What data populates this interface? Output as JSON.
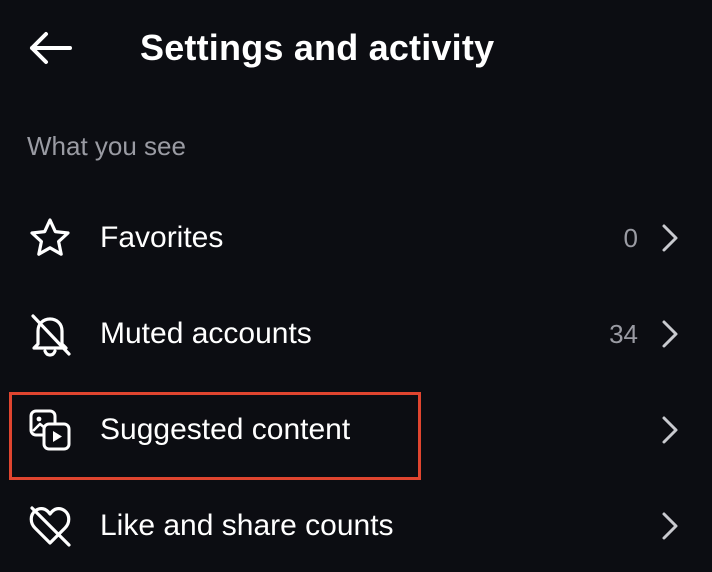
{
  "header": {
    "back_icon": "arrow-left-icon",
    "title": "Settings and activity"
  },
  "section": {
    "label": "What you see"
  },
  "menu": {
    "items": [
      {
        "label": "Favorites",
        "icon": "star-icon",
        "count": "0"
      },
      {
        "label": "Muted accounts",
        "icon": "bell-off-icon",
        "count": "34"
      },
      {
        "label": "Suggested content",
        "icon": "suggested-media-icon",
        "count": ""
      },
      {
        "label": "Like and share counts",
        "icon": "heart-off-icon",
        "count": ""
      }
    ]
  },
  "annotation": {
    "highlight_color": "#e0452f",
    "highlighted_item": "Suggested content"
  },
  "colors": {
    "background": "#0c0d12",
    "text_primary": "#ffffff",
    "text_secondary": "#9a9ba3"
  }
}
